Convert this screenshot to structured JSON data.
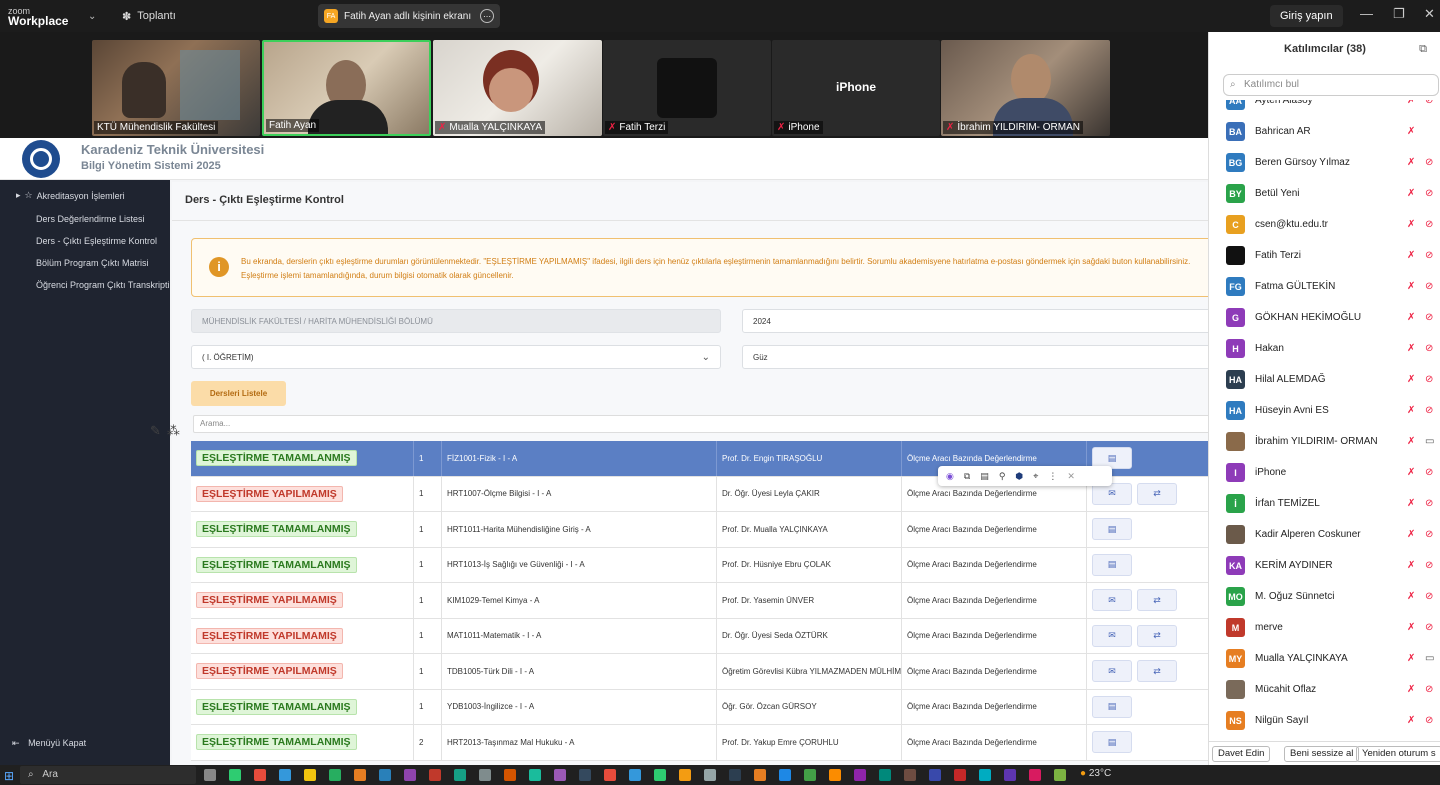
{
  "zoom": {
    "logo_line1": "zoom",
    "logo_line2": "Workplace",
    "meeting_label": "Toplantı",
    "share_initials": "FA",
    "share_title": "Fatih Ayan adlı kişinin ekranı",
    "sign_in": "Giriş yapın"
  },
  "videos": [
    {
      "name": "KTÜ Mühendislik Fakültesi",
      "muted": false
    },
    {
      "name": "Fatih Ayan",
      "muted": false
    },
    {
      "name": "Mualla YALÇINKAYA",
      "muted": true
    },
    {
      "name": "Fatih Terzi",
      "muted": true
    },
    {
      "name": "iPhone",
      "muted": true
    },
    {
      "name": "İbrahim YILDIRIM- ORMAN",
      "muted": true
    }
  ],
  "iphone_label": "iPhone",
  "app": {
    "uni_name": "Karadeniz Teknik Üniversitesi",
    "system_name": "Bilgi Yönetim Sistemi 2025",
    "sidebar": {
      "section": "Akreditasyon İşlemleri",
      "items": [
        "Ders Değerlendirme Listesi",
        "Ders - Çıktı Eşleştirme Kontrol",
        "Bölüm Program Çıktı Matrisi",
        "Öğrenci Program Çıktı Transkripti"
      ],
      "collapse": "Menüyü Kapat"
    },
    "page_title": "Ders - Çıktı Eşleştirme Kontrol",
    "info_text": "Bu ekranda, derslerin çıktı eşleştirme durumları görüntülenmektedir. \"EŞLEŞTİRME YAPILMAMIŞ\" ifadesi, ilgili ders için henüz çıktılarla eşleştirmenin tamamlanmadığını belirtir. Sorumlu akademisyene hatırlatma e-postası göndermek için sağdaki buton kullanabilirsiniz. Eşleştirme işlemi tamamlandığında, durum bilgisi otomatik olarak güncellenir.",
    "filters": {
      "department": "MÜHENDİSLİK FAKÜLTESİ / HARİTA MÜHENDİSLİĞİ BÖLÜMÜ",
      "year": "2024",
      "education": "( I. ÖĞRETİM)",
      "term": "Güz"
    },
    "list_button": "Dersleri Listele",
    "search_placeholder": "Arama...",
    "rows": [
      {
        "status": "EŞLEŞTİRME TAMAMLANMIŞ",
        "ok": true,
        "n": "1",
        "course": "FİZ1001-Fizik - I - A",
        "teacher": "Prof. Dr. Engin TIRAŞOĞLU",
        "method": "Ölçme Aracı Bazında Değerlendirme",
        "sel": true,
        "mail": false
      },
      {
        "status": "EŞLEŞTİRME YAPILMAMIŞ",
        "ok": false,
        "n": "1",
        "course": "HRT1007-Ölçme Bilgisi - I - A",
        "teacher": "Dr. Öğr. Üyesi Leyla ÇAKIR",
        "method": "Ölçme Aracı Bazında Değerlendirme",
        "mail": true
      },
      {
        "status": "EŞLEŞTİRME TAMAMLANMIŞ",
        "ok": true,
        "n": "1",
        "course": "HRT1011-Harita Mühendisliğine Giriş - A",
        "teacher": "Prof. Dr. Mualla YALÇINKAYA",
        "method": "Ölçme Aracı Bazında Değerlendirme",
        "mail": false
      },
      {
        "status": "EŞLEŞTİRME TAMAMLANMIŞ",
        "ok": true,
        "n": "1",
        "course": "HRT1013-İş Sağlığı ve Güvenliği - I - A",
        "teacher": "Prof. Dr. Hüsniye Ebru ÇOLAK",
        "method": "Ölçme Aracı Bazında Değerlendirme",
        "mail": false
      },
      {
        "status": "EŞLEŞTİRME YAPILMAMIŞ",
        "ok": false,
        "n": "1",
        "course": "KIM1029-Temel Kimya - A",
        "teacher": "Prof. Dr. Yasemin ÜNVER",
        "method": "Ölçme Aracı Bazında Değerlendirme",
        "mail": true
      },
      {
        "status": "EŞLEŞTİRME YAPILMAMIŞ",
        "ok": false,
        "n": "1",
        "course": "MAT1011-Matematik - I - A",
        "teacher": "Dr. Öğr. Üyesi Seda ÖZTÜRK",
        "method": "Ölçme Aracı Bazında Değerlendirme",
        "mail": true
      },
      {
        "status": "EŞLEŞTİRME YAPILMAMIŞ",
        "ok": false,
        "n": "1",
        "course": "TDB1005-Türk Dili - I - A",
        "teacher": "Öğretim Görevlisi Kübra YILMAZMADEN MÜLHİM",
        "method": "Ölçme Aracı Bazında Değerlendirme",
        "mail": true
      },
      {
        "status": "EŞLEŞTİRME TAMAMLANMIŞ",
        "ok": true,
        "n": "1",
        "course": "YDB1003-İngilizce - I - A",
        "teacher": "Öğr. Gör. Özcan GÜRSOY",
        "method": "Ölçme Aracı Bazında Değerlendirme",
        "mail": false
      },
      {
        "status": "EŞLEŞTİRME TAMAMLANMIŞ",
        "ok": true,
        "n": "2",
        "course": "HRT2013-Taşınmaz Mal Hukuku - A",
        "teacher": "Prof. Dr. Yakup Emre ÇORUHLU",
        "method": "Ölçme Aracı Bazında Değerlendirme",
        "mail": false
      }
    ]
  },
  "participants": {
    "title": "Katılımcılar (38)",
    "search_placeholder": "Katılımcı bul",
    "list": [
      {
        "initials": "AA",
        "name": "Ayten Alasoy",
        "color": "#2f7bbf",
        "cam": "off"
      },
      {
        "initials": "BA",
        "name": "Bahrican AR",
        "color": "#3a6fb8",
        "cam": "none"
      },
      {
        "initials": "BG",
        "name": "Beren Gürsoy Yılmaz",
        "color": "#2f7bbf",
        "cam": "off"
      },
      {
        "initials": "BY",
        "name": "Betül Yeni",
        "color": "#2aa34a",
        "cam": "off"
      },
      {
        "initials": "C",
        "name": "csen@ktu.edu.tr",
        "color": "#e8a020",
        "cam": "off"
      },
      {
        "initials": "",
        "name": "Fatih Terzi",
        "color": "#111111",
        "cam": "off"
      },
      {
        "initials": "FG",
        "name": "Fatma GÜLTEKİN",
        "color": "#2f7bbf",
        "cam": "off"
      },
      {
        "initials": "G",
        "name": "GÖKHAN HEKİMOĞLU",
        "color": "#8e3bb8",
        "cam": "off"
      },
      {
        "initials": "H",
        "name": "Hakan",
        "color": "#8e3bb8",
        "cam": "off"
      },
      {
        "initials": "HA",
        "name": "Hilal ALEMDAĞ",
        "color": "#2c3e50",
        "cam": "off"
      },
      {
        "initials": "HA",
        "name": "Hüseyin Avni ES",
        "color": "#2f7bbf",
        "cam": "off"
      },
      {
        "initials": "",
        "name": "İbrahim YILDIRIM- ORMAN",
        "color": "#8a6a4a",
        "cam": "on"
      },
      {
        "initials": "I",
        "name": "iPhone",
        "color": "#8e3bb8",
        "cam": "off"
      },
      {
        "initials": "İ",
        "name": "İrfan TEMİZEL",
        "color": "#2aa34a",
        "cam": "off"
      },
      {
        "initials": "",
        "name": "Kadir Alperen Coskuner",
        "color": "#6b5a4a",
        "cam": "off"
      },
      {
        "initials": "KA",
        "name": "KERİM AYDINER",
        "color": "#8e3bb8",
        "cam": "off"
      },
      {
        "initials": "MO",
        "name": "M. Oğuz Sünnetci",
        "color": "#2aa34a",
        "cam": "off"
      },
      {
        "initials": "M",
        "name": "merve",
        "color": "#c0392b",
        "cam": "off"
      },
      {
        "initials": "MY",
        "name": "Mualla YALÇINKAYA",
        "color": "#e67e22",
        "cam": "on"
      },
      {
        "initials": "",
        "name": "Mücahit Oflaz",
        "color": "#7a6a5a",
        "cam": "off"
      },
      {
        "initials": "NS",
        "name": "Nilgün Sayıl",
        "color": "#e67e22",
        "cam": "off"
      }
    ],
    "footer": [
      "Davet Edin",
      "Beni sessize al",
      "Yeniden oturum s"
    ]
  },
  "taskbar": {
    "search": "Ara",
    "temp": "23°C"
  }
}
